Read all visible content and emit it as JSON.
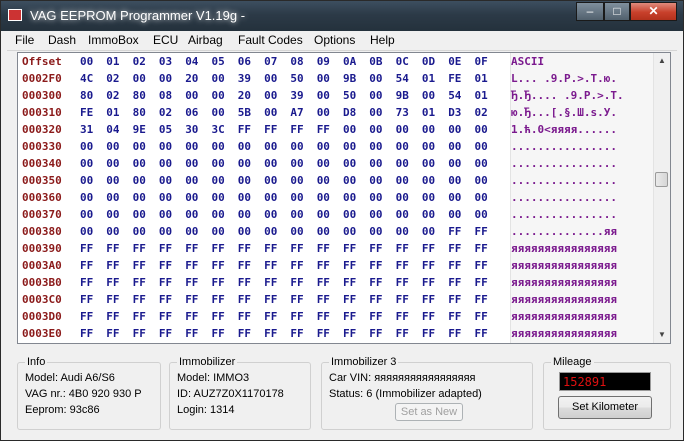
{
  "window": {
    "title": "VAG EEPROM Programmer  V1.19g -",
    "min_label": "–",
    "max_label": "□",
    "close_label": "✕"
  },
  "menu": [
    {
      "label": "File"
    },
    {
      "label": "Dash"
    },
    {
      "label": "ImmoBox"
    },
    {
      "label": "ECU"
    },
    {
      "label": "Airbag"
    },
    {
      "label": "Fault Codes"
    },
    {
      "label": "Options"
    },
    {
      "label": "Help"
    }
  ],
  "hex": {
    "header": {
      "offset_label": "Offset",
      "bytes": [
        "00",
        "01",
        "02",
        "03",
        "04",
        "05",
        "06",
        "07",
        "08",
        "09",
        "0A",
        "0B",
        "0C",
        "0D",
        "0E",
        "0F"
      ],
      "ascii_label": "ASCII"
    },
    "rows": [
      {
        "addr": "0002F0",
        "bytes": [
          "4C",
          "02",
          "00",
          "00",
          "20",
          "00",
          "39",
          "00",
          "50",
          "00",
          "9B",
          "00",
          "54",
          "01",
          "FE",
          "01"
        ],
        "ascii": "L... .9.P.>.T.ю."
      },
      {
        "addr": "000300",
        "bytes": [
          "80",
          "02",
          "80",
          "08",
          "00",
          "00",
          "20",
          "00",
          "39",
          "00",
          "50",
          "00",
          "9B",
          "00",
          "54",
          "01"
        ],
        "ascii": "Ђ.Ђ.... .9.P.>.T."
      },
      {
        "addr": "000310",
        "bytes": [
          "FE",
          "01",
          "80",
          "02",
          "06",
          "00",
          "5B",
          "00",
          "A7",
          "00",
          "D8",
          "00",
          "73",
          "01",
          "D3",
          "02"
        ],
        "ascii": "ю.Ђ...[.§.Ш.s.У."
      },
      {
        "addr": "000320",
        "bytes": [
          "31",
          "04",
          "9E",
          "05",
          "30",
          "3C",
          "FF",
          "FF",
          "FF",
          "FF",
          "00",
          "00",
          "00",
          "00",
          "00",
          "00"
        ],
        "ascii": "1.ћ.0<яяяя......"
      },
      {
        "addr": "000330",
        "bytes": [
          "00",
          "00",
          "00",
          "00",
          "00",
          "00",
          "00",
          "00",
          "00",
          "00",
          "00",
          "00",
          "00",
          "00",
          "00",
          "00"
        ],
        "ascii": "................"
      },
      {
        "addr": "000340",
        "bytes": [
          "00",
          "00",
          "00",
          "00",
          "00",
          "00",
          "00",
          "00",
          "00",
          "00",
          "00",
          "00",
          "00",
          "00",
          "00",
          "00"
        ],
        "ascii": "................"
      },
      {
        "addr": "000350",
        "bytes": [
          "00",
          "00",
          "00",
          "00",
          "00",
          "00",
          "00",
          "00",
          "00",
          "00",
          "00",
          "00",
          "00",
          "00",
          "00",
          "00"
        ],
        "ascii": "................"
      },
      {
        "addr": "000360",
        "bytes": [
          "00",
          "00",
          "00",
          "00",
          "00",
          "00",
          "00",
          "00",
          "00",
          "00",
          "00",
          "00",
          "00",
          "00",
          "00",
          "00"
        ],
        "ascii": "................"
      },
      {
        "addr": "000370",
        "bytes": [
          "00",
          "00",
          "00",
          "00",
          "00",
          "00",
          "00",
          "00",
          "00",
          "00",
          "00",
          "00",
          "00",
          "00",
          "00",
          "00"
        ],
        "ascii": "................"
      },
      {
        "addr": "000380",
        "bytes": [
          "00",
          "00",
          "00",
          "00",
          "00",
          "00",
          "00",
          "00",
          "00",
          "00",
          "00",
          "00",
          "00",
          "00",
          "FF",
          "FF"
        ],
        "ascii": "..............яя"
      },
      {
        "addr": "000390",
        "bytes": [
          "FF",
          "FF",
          "FF",
          "FF",
          "FF",
          "FF",
          "FF",
          "FF",
          "FF",
          "FF",
          "FF",
          "FF",
          "FF",
          "FF",
          "FF",
          "FF"
        ],
        "ascii": "яяяяяяяяяяяяяяяя"
      },
      {
        "addr": "0003A0",
        "bytes": [
          "FF",
          "FF",
          "FF",
          "FF",
          "FF",
          "FF",
          "FF",
          "FF",
          "FF",
          "FF",
          "FF",
          "FF",
          "FF",
          "FF",
          "FF",
          "FF"
        ],
        "ascii": "яяяяяяяяяяяяяяяя"
      },
      {
        "addr": "0003B0",
        "bytes": [
          "FF",
          "FF",
          "FF",
          "FF",
          "FF",
          "FF",
          "FF",
          "FF",
          "FF",
          "FF",
          "FF",
          "FF",
          "FF",
          "FF",
          "FF",
          "FF"
        ],
        "ascii": "яяяяяяяяяяяяяяяя"
      },
      {
        "addr": "0003C0",
        "bytes": [
          "FF",
          "FF",
          "FF",
          "FF",
          "FF",
          "FF",
          "FF",
          "FF",
          "FF",
          "FF",
          "FF",
          "FF",
          "FF",
          "FF",
          "FF",
          "FF"
        ],
        "ascii": "яяяяяяяяяяяяяяяя"
      },
      {
        "addr": "0003D0",
        "bytes": [
          "FF",
          "FF",
          "FF",
          "FF",
          "FF",
          "FF",
          "FF",
          "FF",
          "FF",
          "FF",
          "FF",
          "FF",
          "FF",
          "FF",
          "FF",
          "FF"
        ],
        "ascii": "яяяяяяяяяяяяяяяя"
      },
      {
        "addr": "0003E0",
        "bytes": [
          "FF",
          "FF",
          "FF",
          "FF",
          "FF",
          "FF",
          "FF",
          "FF",
          "FF",
          "FF",
          "FF",
          "FF",
          "FF",
          "FF",
          "FF",
          "FF"
        ],
        "ascii": "яяяяяяяяяяяяяяяя"
      }
    ]
  },
  "info": {
    "label": "Info",
    "model": "Model:  Audi A6/S6",
    "vag_nr": "VAG nr.: 4B0 920 930 P",
    "eeprom": "Eeprom: 93c86"
  },
  "immobilizer": {
    "label": "Immobilizer",
    "model": "Model:  IMMO3",
    "id": "ID: AUZ7Z0X1170178",
    "login": "Login: 1314"
  },
  "immobilizer3": {
    "label": "Immobilizer 3",
    "vin": "Car VIN: яяяяяяяяяяяяяяяяя",
    "status": "Status: 6 (Immobilizer adapted)",
    "set_as_new": "Set as New"
  },
  "mileage": {
    "label": "Mileage",
    "value": "152891",
    "set_button": "Set Kilometer"
  }
}
